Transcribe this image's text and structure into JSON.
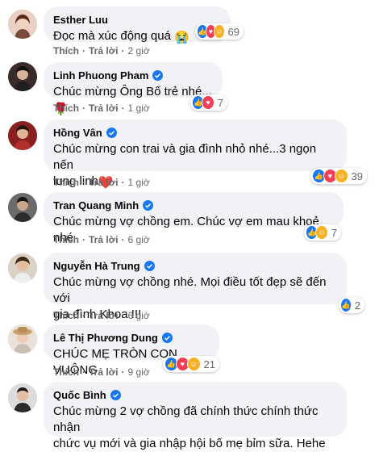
{
  "labels": {
    "like": "Thích",
    "reply": "Trả lời",
    "separator": "·"
  },
  "comments": [
    {
      "author": "Esther Luu",
      "text": "Đọc mà xúc động quá",
      "emoji": "😭",
      "time": "2 giờ",
      "reaction_count": "69"
    },
    {
      "author": "Linh Phuong Pham",
      "text": "Chúc mừng Ông Bố trẻ nhé...",
      "emoji": "🌹",
      "time": "1 giờ",
      "reaction_count": "7"
    },
    {
      "author": "Hồng Vân",
      "text_line1": "Chúc mừng con trai và gia đình nhỏ nhé...3 ngọn nến",
      "text_line2": "lung linh",
      "emoji": "❤️",
      "time": "1 giờ",
      "reaction_count": "39"
    },
    {
      "author": "Tran Quang Minh",
      "text": "Chúc mừng vợ chồng em. Chúc vợ em mau khoẻ nhé",
      "time": "6 giờ",
      "reaction_count": "7"
    },
    {
      "author": "Nguyễn Hà Trung",
      "text_line1": "Chúc mừng vợ chồng nhé. Mọi điều tốt đẹp sẽ đến với",
      "text_line2": "gia đình Khoa !!!",
      "time": "6 giờ",
      "reaction_count": "2"
    },
    {
      "author": "Lê Thị Phương Dung",
      "text": "CHÚC MẸ TRÒN CON VUÔNG",
      "time": "9 giờ",
      "reaction_count": "21"
    },
    {
      "author": "Quốc Bình",
      "text_line1": "Chúc mừng 2 vợ chồng đã chính thức chính thức nhận",
      "text_line2": "chức vụ mới và gia nhập hội bố mẹ bỉm sữa. Hehe"
    }
  ],
  "colors": {
    "bubble": "#f0f2f5",
    "meta": "#65676b",
    "like": "#1877f2",
    "love": "#f33e58",
    "care": "#f7b125"
  },
  "icons": [
    "verified-badge-icon",
    "like-reaction-icon",
    "love-reaction-icon",
    "care-reaction-icon",
    "haha-reaction-icon"
  ]
}
